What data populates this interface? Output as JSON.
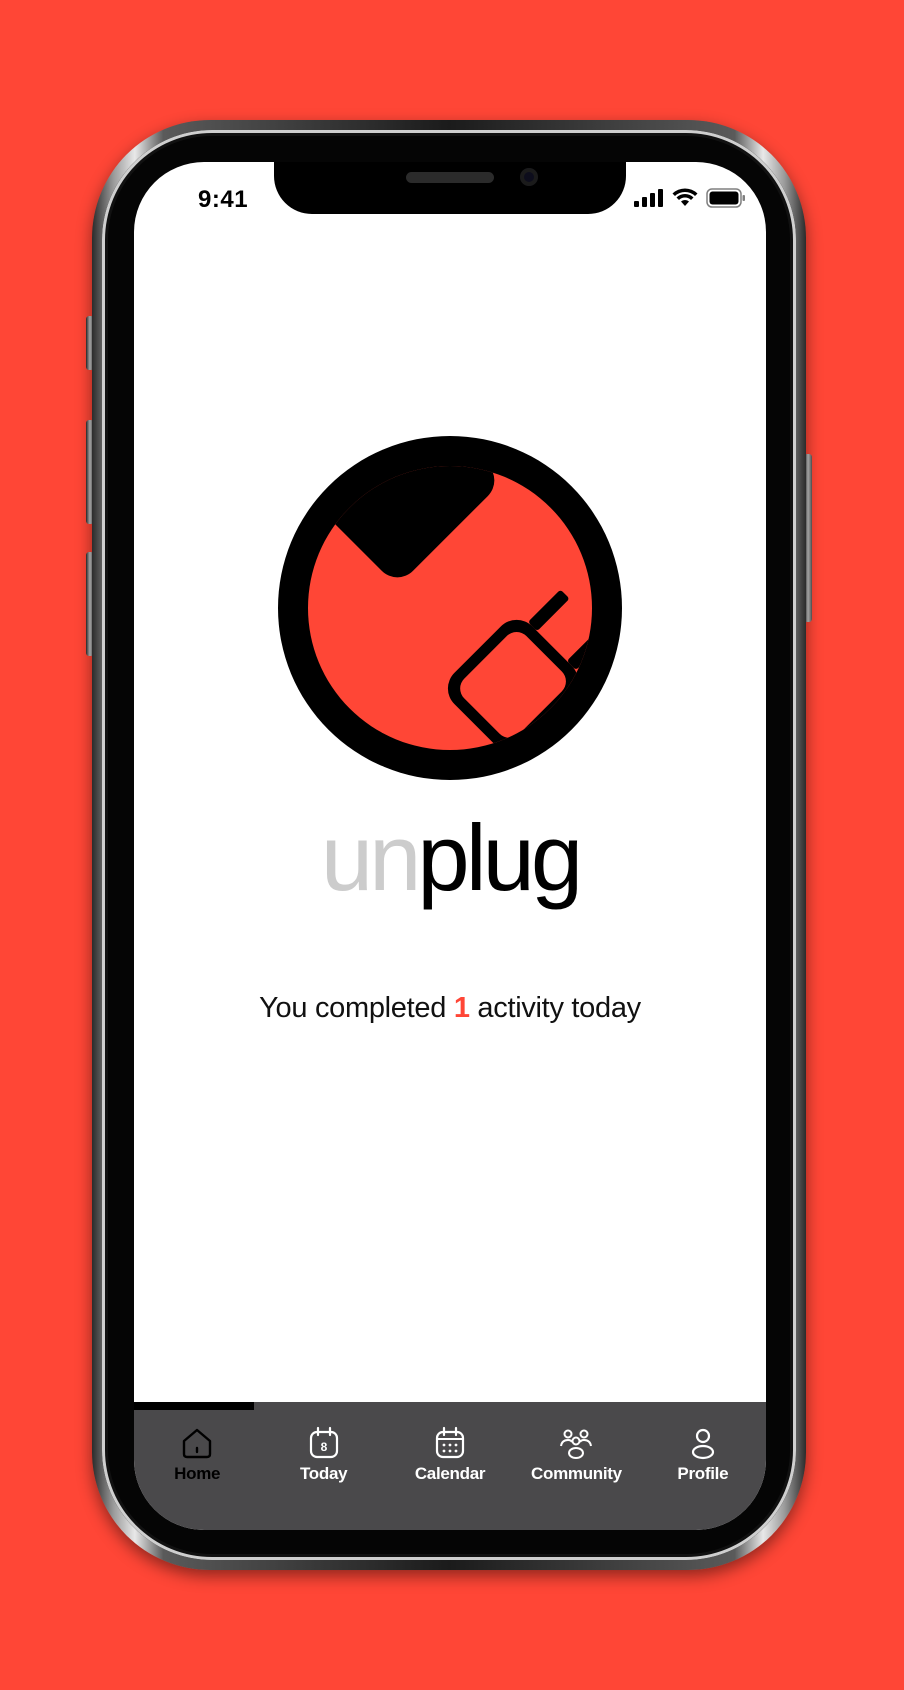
{
  "status_bar": {
    "time": "9:41"
  },
  "brand": {
    "prefix": "un",
    "suffix": "plug"
  },
  "summary": {
    "before": "You completed ",
    "count": "1",
    "after": " activity today"
  },
  "daily_progress": 0.19,
  "tabs": [
    {
      "label": "Home",
      "icon": "home-icon",
      "active": true
    },
    {
      "label": "Today",
      "icon": "calendar-day-icon",
      "day": "8",
      "active": false
    },
    {
      "label": "Calendar",
      "icon": "calendar-icon",
      "active": false
    },
    {
      "label": "Community",
      "icon": "community-icon",
      "active": false
    },
    {
      "label": "Profile",
      "icon": "profile-icon",
      "active": false
    }
  ],
  "colors": {
    "background": "#ff4636",
    "accent": "#ff4636",
    "tabbar": "#4a494b",
    "muted_text": "#cccccc"
  }
}
